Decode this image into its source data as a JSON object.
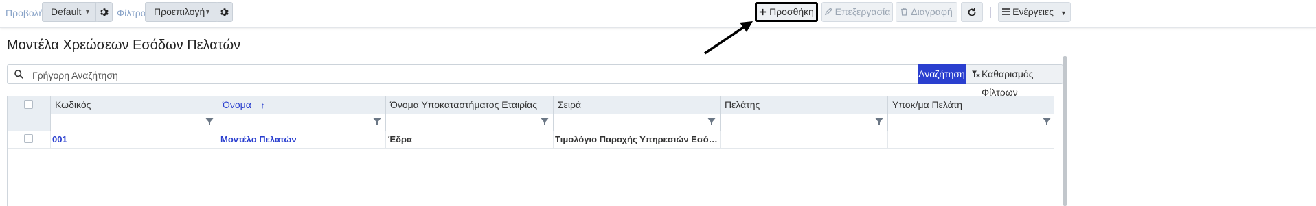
{
  "toolbar": {
    "view_label": "Προβολή",
    "view_value": "Default",
    "filters_label": "Φίλτρα",
    "filters_value": "Προεπιλογή",
    "add_label": "Προσθήκη",
    "edit_label": "Επεξεργασία",
    "delete_label": "Διαγραφή",
    "actions_label": "Ενέργειες"
  },
  "page": {
    "title": "Μοντέλα Χρεώσεων Εσόδων Πελατών"
  },
  "search": {
    "placeholder": "Γρήγορη Αναζήτηση",
    "search_button": "Αναζήτηση",
    "clear_button": "Καθαρισμός Φίλτρων"
  },
  "grid": {
    "columns": [
      {
        "label": "Κωδικός",
        "sorted": false
      },
      {
        "label": "Όνομα",
        "sorted": true,
        "sort_indicator": "↑"
      },
      {
        "label": "Όνομα Υποκαταστήματος Εταιρίας",
        "sorted": false
      },
      {
        "label": "Σειρά",
        "sorted": false
      },
      {
        "label": "Πελάτης",
        "sorted": false
      },
      {
        "label": "Υποκ/μα Πελάτη",
        "sorted": false
      }
    ],
    "rows": [
      {
        "code": "001",
        "name": "Μοντέλο Πελατών",
        "branch": "Έδρα",
        "series": "Τιμολόγιο Παροχής Υπηρεσιών Εσόδων...",
        "customer": "",
        "customer_branch": ""
      }
    ]
  },
  "colors": {
    "accent": "#2a3fcf",
    "header_bg": "#e9eef3",
    "toolbar_label": "#8aa4c8"
  }
}
